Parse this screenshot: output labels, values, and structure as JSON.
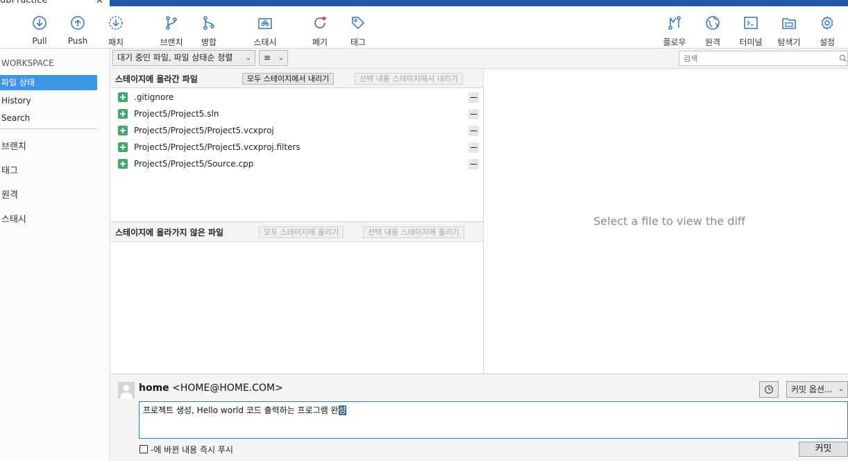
{
  "window": {
    "tab_title": "ubPractice",
    "tab_close": "✕"
  },
  "toolbar": {
    "items": [
      {
        "label": "Pull",
        "icon": "pull-icon"
      },
      {
        "label": "Push",
        "icon": "push-icon"
      },
      {
        "label": "패치",
        "icon": "fetch-icon"
      },
      {
        "label": "브랜치",
        "icon": "branch-icon"
      },
      {
        "label": "병합",
        "icon": "merge-icon"
      },
      {
        "label": "스태시",
        "icon": "stash-icon"
      },
      {
        "label": "폐기",
        "icon": "discard-icon"
      },
      {
        "label": "태그",
        "icon": "tag-icon"
      },
      {
        "label": "플로우",
        "icon": "flow-icon"
      },
      {
        "label": "원격",
        "icon": "globe-icon"
      },
      {
        "label": "터미널",
        "icon": "terminal-icon"
      },
      {
        "label": "탐색기",
        "icon": "folder-icon"
      },
      {
        "label": "설정",
        "icon": "gear-icon"
      }
    ]
  },
  "sidebar": {
    "workspace_label": "WORKSPACE",
    "items": [
      {
        "label": "파일 상태",
        "selected": true
      },
      {
        "label": "History",
        "selected": false
      },
      {
        "label": "Search",
        "selected": false
      }
    ],
    "sections": [
      "브랜치",
      "태그",
      "원격",
      "스태시"
    ]
  },
  "filterbar": {
    "filter_value": "대기 중인 파일, 파일 상태순 정렬",
    "view_value": "≡",
    "search_placeholder": "검색"
  },
  "staged": {
    "title": "스테이지에 올라간 파일",
    "unstage_all_label": "모두 스테이지에서 내리기",
    "unstage_selected_label": "선택 내용 스테이지에서 내리기",
    "files": [
      ".gitignore",
      "Project5/Project5.sln",
      "Project5/Project5/Project5.vcxproj",
      "Project5/Project5/Project5.vcxproj.filters",
      "Project5/Project5/Source.cpp"
    ]
  },
  "unstaged": {
    "title": "스테이지에 올라가지 않은 파일",
    "stage_all_label": "모두 스테이지에 올리기",
    "stage_selected_label": "선택 내용 스테이지에 올리기"
  },
  "diff": {
    "empty_message": "Select a file to view the diff"
  },
  "commit": {
    "author_name": "home",
    "author_email": "<HOME@HOME.COM>",
    "options_label": "커밋 옵션...",
    "message_text": "프로젝트 생성, Hello world 코드 출력하는 프로그램 완",
    "message_selected": "성",
    "push_checkbox_label": "-에 바뀐 내용 즉시 푸시",
    "commit_button_label": "커밋"
  },
  "colors": {
    "accent_blue": "#1f5aa8",
    "selection": "#3a97e8",
    "added_green": "#3cab6a",
    "icon_blue": "#2a73c4",
    "discard_red": "#e0483a"
  }
}
